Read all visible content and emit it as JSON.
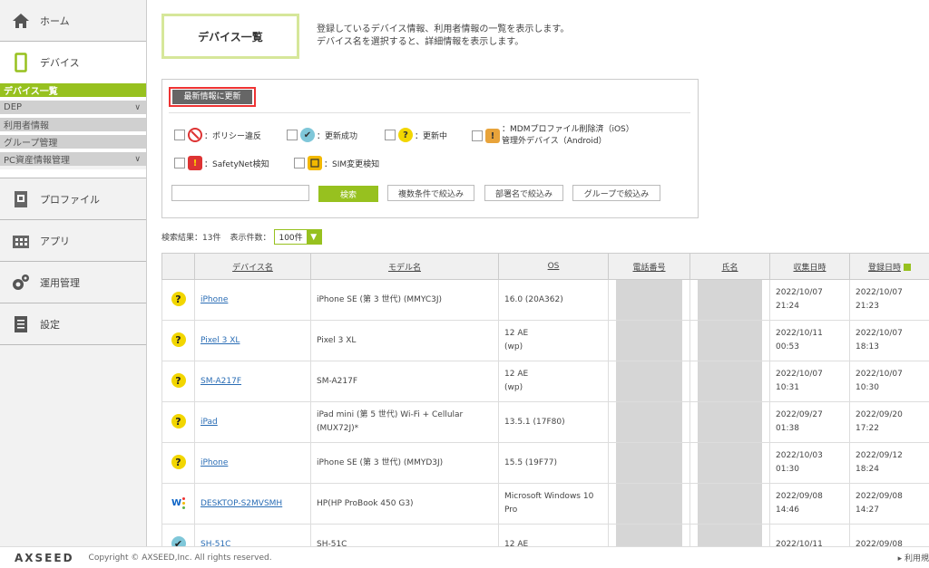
{
  "sidebar": {
    "home": "ホーム",
    "device": "デバイス",
    "sub_items": [
      {
        "label": "デバイス一覧",
        "active": true
      },
      {
        "label": "DEP",
        "chevron": "∨"
      },
      {
        "label": "利用者情報"
      },
      {
        "label": "グループ管理"
      },
      {
        "label": "PC資産情報管理",
        "chevron": "∨"
      }
    ],
    "profile": "プロファイル",
    "app": "アプリ",
    "ops": "運用管理",
    "settings": "設定"
  },
  "page": {
    "title": "デバイス一覧",
    "desc_line1": "登録しているデバイス情報、利用者情報の一覧を表示します。",
    "desc_line2": "デバイス名を選択すると、詳細情報を表示します。"
  },
  "filter": {
    "refresh_label": "最新情報に更新",
    "statuses": {
      "policy": "：ポリシー違反",
      "success": "：更新成功",
      "updating": "：更新中",
      "mdm_line1": "：MDMプロファイル削除済（iOS）",
      "mdm_line2": "管理外デバイス（Android）",
      "safetynet": "：SafetyNet検知",
      "sim": "：SIM変更検知"
    },
    "search_placeholder": "",
    "search_label": "検索",
    "multi_label": "複数条件で絞込み",
    "dept_label": "部署名で絞込み",
    "group_label": "グループで絞込み"
  },
  "results": {
    "count_label": "検索結果：13件",
    "per_page_label": "表示件数：",
    "per_page_value": "100件"
  },
  "table": {
    "headers": [
      "デバイス名",
      "モデル名",
      "OS",
      "電話番号",
      "氏名",
      "収集日時",
      "登録日時"
    ],
    "rows": [
      {
        "status": "updating",
        "name": "iPhone",
        "model": "iPhone SE (第 3 世代) (MMYC3J)",
        "os": "16.0 (20A362)",
        "collected": "2022/10/07\n21:24",
        "registered": "2022/10/07\n21:23"
      },
      {
        "status": "updating",
        "name": "Pixel 3 XL",
        "model": "Pixel 3 XL",
        "os": "12 AE\n(wp)",
        "collected": "2022/10/11\n00:53",
        "registered": "2022/10/07\n18:13"
      },
      {
        "status": "updating",
        "name": "SM-A217F",
        "model": "SM-A217F",
        "os": "12 AE\n(wp)",
        "collected": "2022/10/07\n10:31",
        "registered": "2022/10/07\n10:30"
      },
      {
        "status": "updating",
        "name": "iPad",
        "model": "iPad mini (第 5 世代) Wi-Fi + Cellular (MUX72J)*",
        "os": "13.5.1 (17F80)",
        "collected": "2022/09/27\n01:38",
        "registered": "2022/09/20\n17:22"
      },
      {
        "status": "updating",
        "name": "iPhone",
        "model": "iPhone SE (第 3 世代) (MMYD3J)",
        "os": "15.5 (19F77)",
        "collected": "2022/10/03\n01:30",
        "registered": "2022/09/12\n18:24"
      },
      {
        "status": "windows",
        "name": "DESKTOP-S2MVSMH",
        "model": "HP(HP ProBook 450 G3)",
        "os": "Microsoft Windows 10\nPro",
        "collected": "2022/09/08\n14:46",
        "registered": "2022/09/08\n14:27"
      },
      {
        "status": "success",
        "name": "SH-51C",
        "model": "SH-51C",
        "os": "12 AE",
        "collected": "2022/10/11",
        "registered": "2022/09/08"
      }
    ]
  },
  "footer": {
    "logo": "AXSEED",
    "copyright": "Copyright © AXSEED,Inc. All rights reserved.",
    "terms": "▸ 利用規"
  },
  "colors": {
    "accent": "#97c11f",
    "highlight_border": "#ee3333"
  }
}
